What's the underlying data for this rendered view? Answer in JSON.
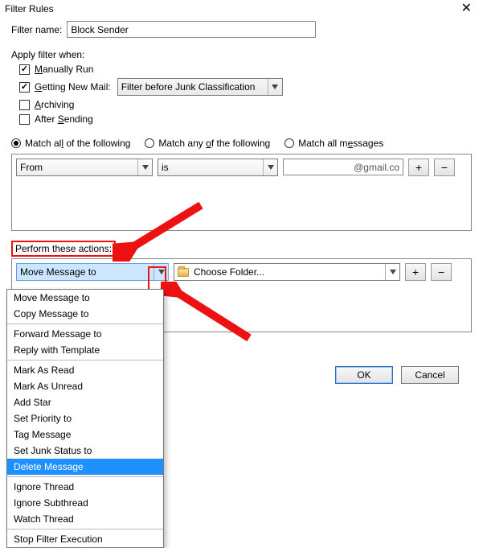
{
  "window": {
    "title": "Filter Rules"
  },
  "filter_name": {
    "label": "Filter name:",
    "value": "Block Sender"
  },
  "apply_when": {
    "label": "Apply filter when:",
    "manually": {
      "label_pre": "",
      "u": "M",
      "label_post": "anually Run",
      "checked": true
    },
    "getting": {
      "label_pre": "",
      "u": "G",
      "label_post": "etting New Mail:",
      "checked": true,
      "combo": "Filter before Junk Classification"
    },
    "archiving": {
      "label_pre": "",
      "u": "A",
      "label_post": "rchiving",
      "checked": false
    },
    "after": {
      "label_pre": "After ",
      "u": "S",
      "label_post": "ending",
      "checked": false
    }
  },
  "match": {
    "all": {
      "pre": "Match al",
      "u": "l",
      "post": " of the following",
      "selected": true
    },
    "any": {
      "pre": "Match any ",
      "u": "o",
      "post": "f the following",
      "selected": false
    },
    "allm": {
      "pre": "Match all m",
      "u": "e",
      "post": "ssages",
      "selected": false
    }
  },
  "cond": {
    "field": "From",
    "op": "is",
    "value": "@gmail.co",
    "plus": "+",
    "minus": "−"
  },
  "actions_label": "Perform these actions:",
  "action": {
    "selected": "Move Message to",
    "folder": "Choose Folder...",
    "plus": "+",
    "minus": "−"
  },
  "dropdown": {
    "groups": [
      [
        "Move Message to",
        "Copy Message to"
      ],
      [
        "Forward Message to",
        "Reply with Template"
      ],
      [
        "Mark As Read",
        "Mark As Unread",
        "Add Star",
        "Set Priority to",
        "Tag Message",
        "Set Junk Status to",
        "Delete Message"
      ],
      [
        "Ignore Thread",
        "Ignore Subthread",
        "Watch Thread"
      ],
      [
        "Stop Filter Execution"
      ]
    ],
    "highlighted": "Delete Message"
  },
  "buttons": {
    "ok": "OK",
    "cancel": "Cancel"
  }
}
